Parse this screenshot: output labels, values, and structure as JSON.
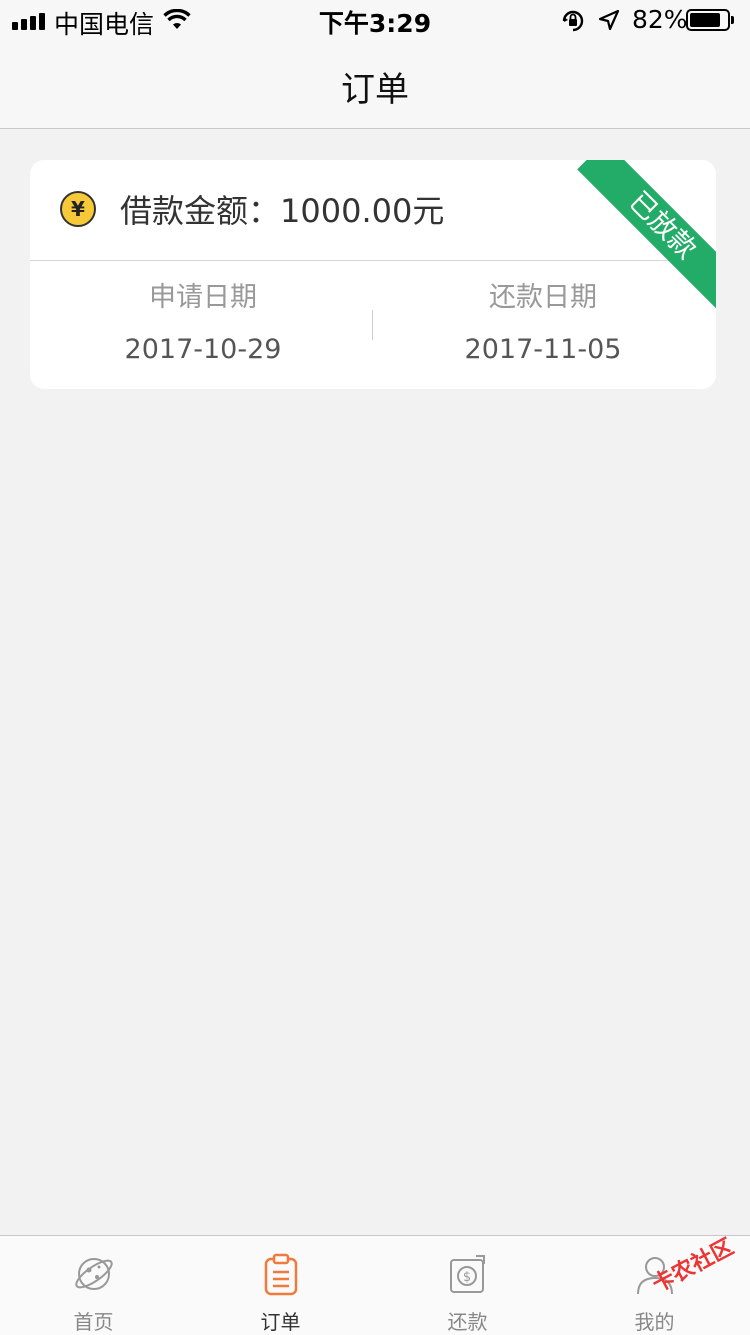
{
  "status_bar": {
    "carrier": "中国电信",
    "time": "下午3:29",
    "battery_percent": "82%",
    "battery_level": 0.82,
    "signal_icon": "signal-bars-icon",
    "wifi_icon": "wifi-icon",
    "lock_icon": "orientation-lock-icon",
    "location_icon": "location-arrow-icon"
  },
  "nav": {
    "title": "订单"
  },
  "order": {
    "currency_icon": "yuan-coin-icon",
    "amount_text": "借款金额：1000.00元",
    "status_ribbon": "已放款",
    "status_color": "#22ac67",
    "apply_date_label": "申请日期",
    "apply_date": "2017-10-29",
    "repay_date_label": "还款日期",
    "repay_date": "2017-11-05"
  },
  "tabs": [
    {
      "label": "首页",
      "icon": "planet-icon",
      "active": false
    },
    {
      "label": "订单",
      "icon": "clipboard-icon",
      "active": true,
      "accent": "#f07a3a"
    },
    {
      "label": "还款",
      "icon": "dollar-refresh-icon",
      "active": false
    },
    {
      "label": "我的",
      "icon": "person-icon",
      "active": false
    }
  ],
  "watermark": "卡农社区"
}
